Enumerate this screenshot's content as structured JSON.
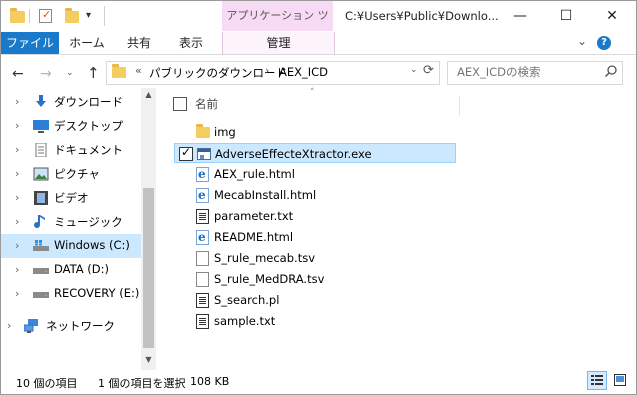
{
  "titlebar": {
    "contextual_tab": "アプリケーション ツール",
    "title": "C:¥Users¥Public¥Downlo...",
    "minimize": "—",
    "maximize": "☐",
    "close": "✕"
  },
  "ribbon": {
    "file": "ファイル",
    "home": "ホーム",
    "share": "共有",
    "view": "表示",
    "manage": "管理",
    "expand": "⌄",
    "help": "?"
  },
  "address": {
    "back": "←",
    "forward": "→",
    "recent": "⌄",
    "up": "↑",
    "overflow": "«",
    "segment1": "パブリックのダウンロード",
    "separator": "›",
    "segment2": "AEX_ICD",
    "dropdown": "⌄",
    "refresh": "⟳",
    "search_placeholder": "AEX_ICDの検索"
  },
  "nav": {
    "scroll_up": "▲",
    "scroll_down": "▼",
    "items": [
      {
        "label": "ダウンロード",
        "icon": "downloads-icon",
        "expander": "›"
      },
      {
        "label": "デスクトップ",
        "icon": "desktop-icon",
        "expander": "›"
      },
      {
        "label": "ドキュメント",
        "icon": "documents-icon",
        "expander": "›"
      },
      {
        "label": "ピクチャ",
        "icon": "pictures-icon",
        "expander": "›"
      },
      {
        "label": "ビデオ",
        "icon": "videos-icon",
        "expander": "›"
      },
      {
        "label": "ミュージック",
        "icon": "music-icon",
        "expander": "›"
      },
      {
        "label": "Windows (C:)",
        "icon": "windows-drive-icon",
        "expander": "›"
      },
      {
        "label": "DATA (D:)",
        "icon": "drive-icon",
        "expander": "›"
      },
      {
        "label": "RECOVERY (E:)",
        "icon": "drive-icon",
        "expander": "›"
      },
      {
        "label": "ネットワーク",
        "icon": "network-icon",
        "expander": "›"
      }
    ]
  },
  "files": {
    "column_name": "名前",
    "sort_indicator": "˄",
    "rows": [
      {
        "name": "img",
        "type": "folder"
      },
      {
        "name": "AdverseEffecteXtractor.exe",
        "type": "exe"
      },
      {
        "name": "AEX_rule.html",
        "type": "html"
      },
      {
        "name": "MecabInstall.html",
        "type": "html"
      },
      {
        "name": "parameter.txt",
        "type": "script"
      },
      {
        "name": "README.html",
        "type": "html"
      },
      {
        "name": "S_rule_mecab.tsv",
        "type": "doc"
      },
      {
        "name": "S_rule_MedDRA.tsv",
        "type": "doc"
      },
      {
        "name": "S_search.pl",
        "type": "script"
      },
      {
        "name": "sample.txt",
        "type": "script"
      }
    ]
  },
  "status": {
    "count": "10 個の項目",
    "selected": "1 個の項目を選択",
    "size": "108 KB"
  },
  "colors": {
    "accent": "#1979ca",
    "selection": "#cce8ff",
    "contextual": "#f7dbf4",
    "folder": "#f3cd5f"
  }
}
